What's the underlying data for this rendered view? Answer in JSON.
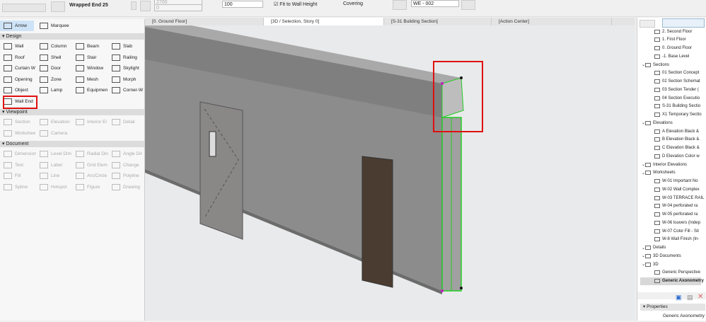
{
  "toolbar": {
    "wall_end_type": "Wrapped End 25",
    "dim1": "2700",
    "dim2": "0",
    "value": "100",
    "fit_label": "Fit to Wall Height",
    "covering_label": "Covering",
    "id_value": "WE - 002"
  },
  "toolbox": {
    "top": [
      {
        "label": "Arrow"
      },
      {
        "label": "Marquee"
      }
    ],
    "design_header": "Design",
    "design": [
      "Wall",
      "Column",
      "Beam",
      "Slab",
      "Roof",
      "Shell",
      "Stair",
      "Railing",
      "Curtain W",
      "Door",
      "Window",
      "Skylight",
      "Opening",
      "Zone",
      "Mesh",
      "Morph",
      "Object",
      "Lamp",
      "Equipmen",
      "Corner-W",
      "Wall End"
    ],
    "viewpoint_header": "Viewpoint",
    "viewpoint": [
      "Section",
      "Elevation",
      "Interior El",
      "Detail",
      "Workshee",
      "Camera"
    ],
    "document_header": "Document",
    "document": [
      "Dimension",
      "Level Dim",
      "Radial Din",
      "Angle Dir",
      "Text",
      "Label",
      "Grid Elem",
      "Change",
      "Fill",
      "Line",
      "Arc/Circle",
      "Polyline",
      "Spline",
      "Hotspot",
      "Figure",
      "Drawing"
    ]
  },
  "tabs": [
    {
      "label": "[0. Ground Floor]"
    },
    {
      "label": "[3D / Selection, Story 0]"
    },
    {
      "label": "[S-31 Building Section]"
    },
    {
      "label": "[Action Center]"
    }
  ],
  "navigator": {
    "items": [
      {
        "label": "2. Second Floor",
        "level": 2
      },
      {
        "label": "1. First Floor",
        "level": 2
      },
      {
        "label": "0. Ground Floor",
        "level": 2
      },
      {
        "label": "-1. Base Level",
        "level": 2
      },
      {
        "label": "Sections",
        "level": 1
      },
      {
        "label": "01 Section Concept",
        "level": 2
      },
      {
        "label": "02 Section Schemat",
        "level": 2
      },
      {
        "label": "03 Section Tender (",
        "level": 2
      },
      {
        "label": "04 Section Executio",
        "level": 2
      },
      {
        "label": "S-31 Building Sectio",
        "level": 2
      },
      {
        "label": "X1 Temporary Sectio",
        "level": 2
      },
      {
        "label": "Elevations",
        "level": 1
      },
      {
        "label": "A Elevation Black &",
        "level": 2
      },
      {
        "label": "B Elevation Black &",
        "level": 2
      },
      {
        "label": "C Elevation Black &",
        "level": 2
      },
      {
        "label": "D Elevation Color w",
        "level": 2
      },
      {
        "label": "Interior Elevations",
        "level": 1
      },
      {
        "label": "Worksheets",
        "level": 1
      },
      {
        "label": "W-01 Important No",
        "level": 2
      },
      {
        "label": "W-02 Wall Complex",
        "level": 2
      },
      {
        "label": "W-03 TERRACE RAIL",
        "level": 2
      },
      {
        "label": "W-04 perforated ra",
        "level": 2
      },
      {
        "label": "W-05 perforated ra",
        "level": 2
      },
      {
        "label": "W-06 louvers (Indep",
        "level": 2
      },
      {
        "label": "W-07 Color Fill - Sit",
        "level": 2
      },
      {
        "label": "W-8 Wall Finish (In-",
        "level": 2
      },
      {
        "label": "Details",
        "level": 1
      },
      {
        "label": "3D Documents",
        "level": 1
      },
      {
        "label": "3D",
        "level": 1
      },
      {
        "label": "Generic Perspective",
        "level": 2
      },
      {
        "label": "Generic Axonometry",
        "level": 2,
        "selected": true
      }
    ],
    "properties_header": "Properties",
    "properties_value": "Generic Axonometry"
  },
  "colors": {
    "highlight": "#e01010",
    "selection": "#22cc22",
    "wall": "#8c8c8c"
  }
}
